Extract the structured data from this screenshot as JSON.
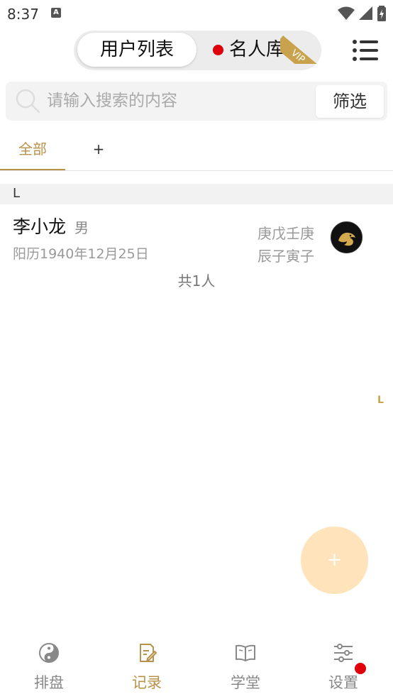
{
  "status_bar": {
    "time": "8:37",
    "notification_icon": "A"
  },
  "header": {
    "tab_user_list": "用户列表",
    "tab_celebrity": "名人库",
    "vip_label": "VIP",
    "accent_color": "#c9a24e",
    "dot_color": "#e0000b"
  },
  "search": {
    "placeholder": "请输入搜索的内容",
    "filter_label": "筛选"
  },
  "tabs": {
    "all_label": "全部",
    "add_label": "+"
  },
  "list": {
    "section_letter": "L",
    "items": [
      {
        "name": "李小龙",
        "gender": "男",
        "date": "阳历1940年12月25日",
        "bazi_line1": "庚戊壬庚",
        "bazi_line2": "辰子寅子"
      }
    ],
    "total": "共1人"
  },
  "index_bar": {
    "letter": "L"
  },
  "fab": {
    "label": "+"
  },
  "bottom_nav": {
    "items": [
      {
        "label": "排盘",
        "icon": "yin-yang-icon",
        "active": false
      },
      {
        "label": "记录",
        "icon": "note-edit-icon",
        "active": true
      },
      {
        "label": "学堂",
        "icon": "book-icon",
        "active": false
      },
      {
        "label": "设置",
        "icon": "sliders-icon",
        "active": false
      }
    ]
  }
}
